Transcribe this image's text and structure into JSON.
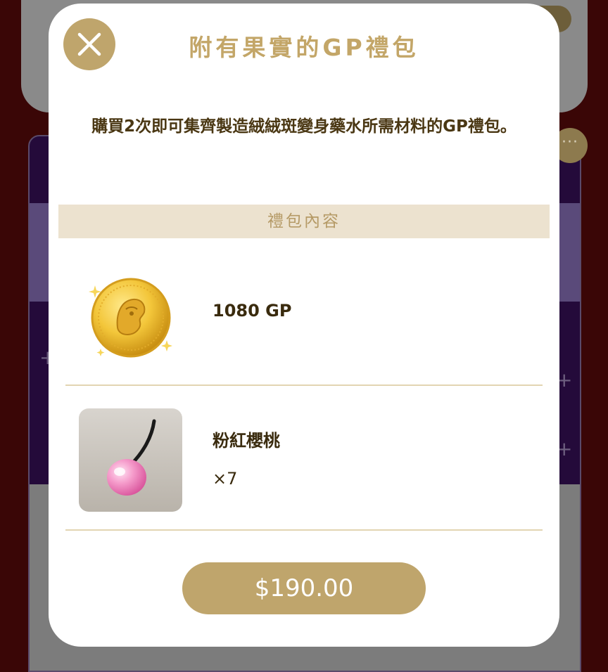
{
  "modal": {
    "title": "附有果實的GP禮包",
    "description": "購買2次即可集齊製造絨絨斑變身藥水所需材料的GP禮包。",
    "contents_header": "禮包內容",
    "items": [
      {
        "name": "1080 GP",
        "quantity": "",
        "icon": "gold-coin-icon"
      },
      {
        "name": "粉紅櫻桃",
        "quantity": "×7",
        "icon": "pink-cherry-icon"
      }
    ],
    "price_label": "$190.00"
  },
  "background": {
    "more_label": "···"
  },
  "colors": {
    "accent_gold": "#bfa56c",
    "title_gold": "#c3a668",
    "header_beige": "#ece2cf",
    "text_brown": "#3a2b0e"
  }
}
